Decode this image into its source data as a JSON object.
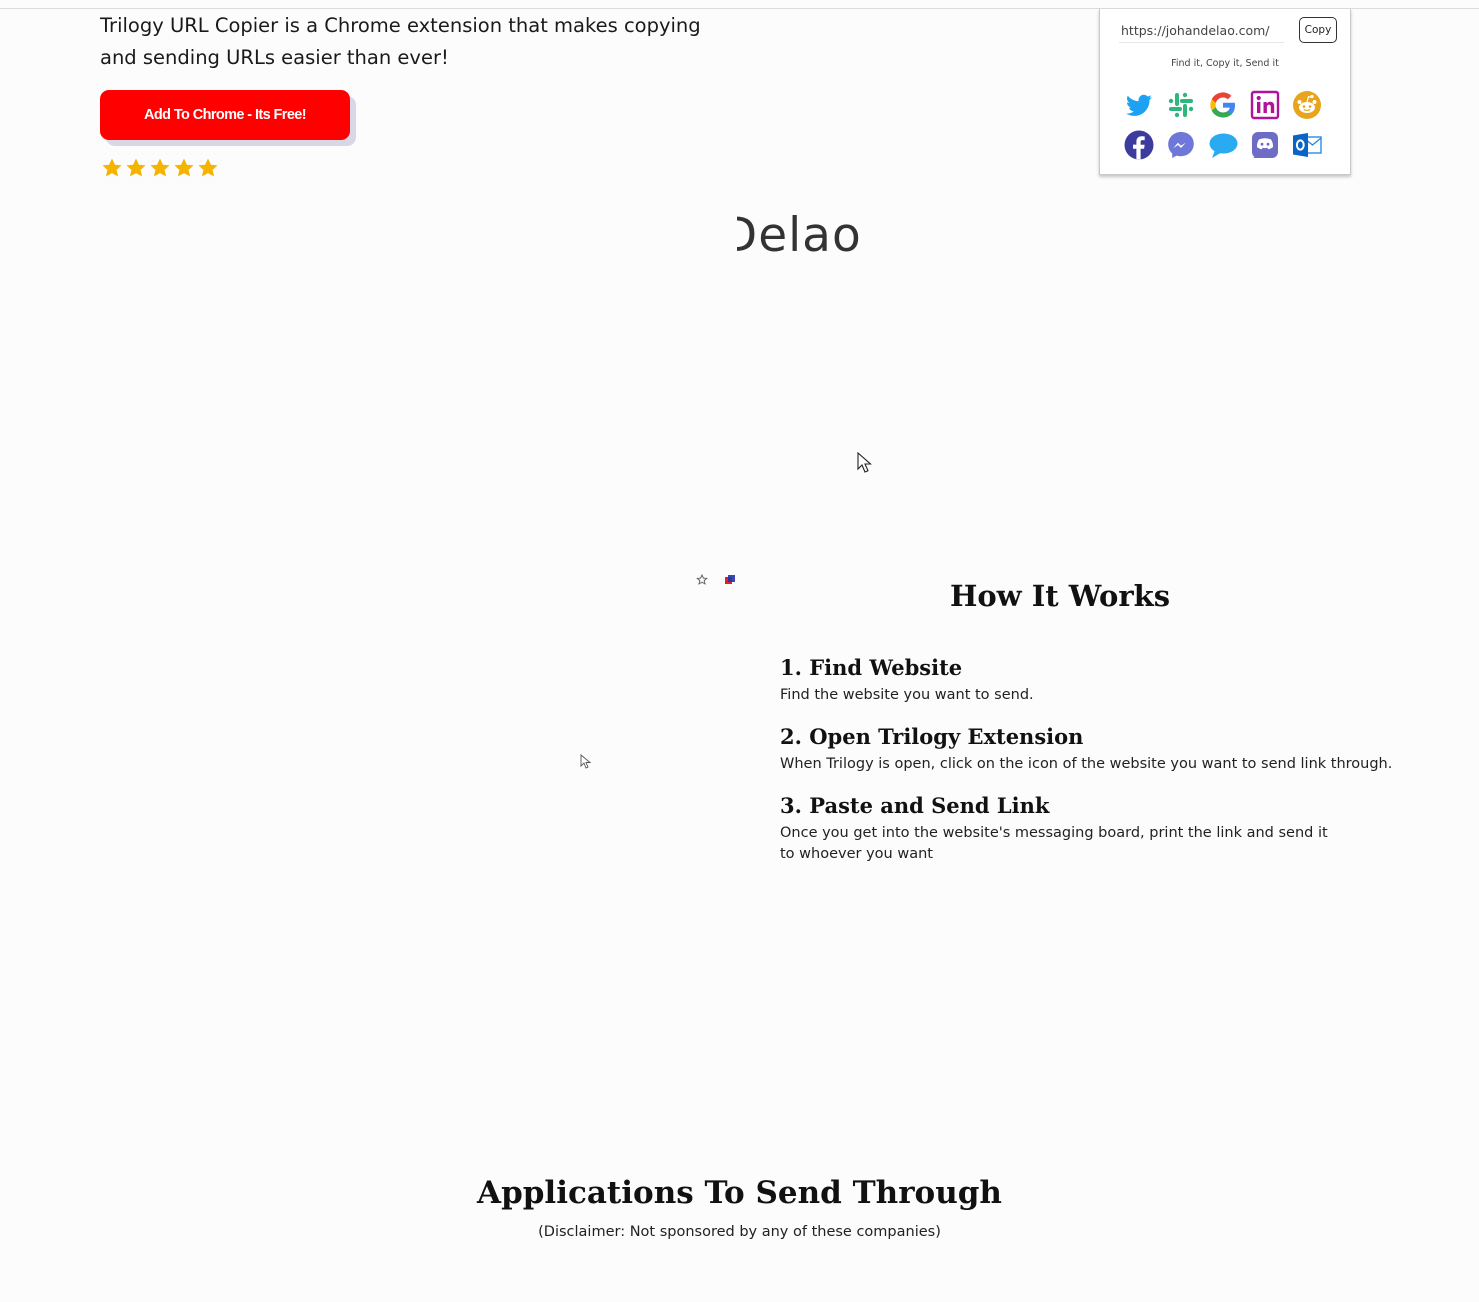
{
  "hero": {
    "description": "Trilogy URL Copier is a Chrome extension that makes copying and sending URLs easier than ever!",
    "cta_label": "Add To Chrome - Its Free!",
    "rating": 5,
    "rating_max": 5
  },
  "popup": {
    "url_value": "https://johandelao.com/",
    "copy_label": "Copy",
    "tagline": "Find it, Copy it, Send it",
    "apps": [
      {
        "icon": "twitter-icon",
        "color": "#1da1f2"
      },
      {
        "icon": "slack-icon",
        "color": "#2eb67d"
      },
      {
        "icon": "google-icon",
        "color": "#ea4335"
      },
      {
        "icon": "linkedin-icon",
        "color": "#b1129b"
      },
      {
        "icon": "reddit-icon",
        "color": "#e8a41a"
      },
      {
        "icon": "facebook-icon",
        "color": "#3b3c9d"
      },
      {
        "icon": "messenger-icon",
        "color": "#6f78d8"
      },
      {
        "icon": "chat-bubble-icon",
        "color": "#2aaaf0"
      },
      {
        "icon": "discord-icon",
        "color": "#6d6dc6"
      },
      {
        "icon": "outlook-icon",
        "color": "#0a64c5"
      }
    ]
  },
  "logo_text": "Delao",
  "how_it_works": {
    "title": "How It Works",
    "steps": [
      {
        "title": "1. Find Website",
        "text": "Find the website you want to send."
      },
      {
        "title": "2. Open Trilogy Extension",
        "text": "When Trilogy is open, click on the icon of the website you want to send link through."
      },
      {
        "title": "3. Paste and Send Link",
        "text": "Once you get into the website's messaging board, print the link and send it to whoever you want"
      }
    ]
  },
  "applications": {
    "title": "Applications To Send Through",
    "disclaimer": "(Disclaimer: Not sponsored by any of these companies)"
  },
  "colors": {
    "cta": "#ff0000",
    "star": "#f5b400"
  }
}
